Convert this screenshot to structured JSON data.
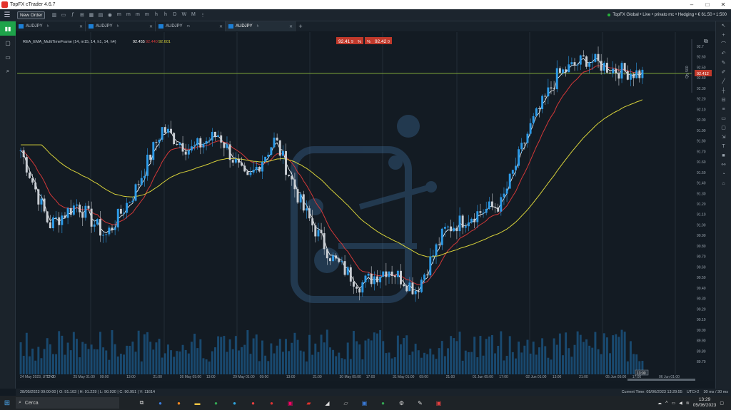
{
  "titlebar": {
    "title": "TopFX cTrader 4.6.7"
  },
  "toolbar": {
    "new_order_label": "New Order",
    "account": "TopFX Global • Live • privato mc • Hedging • € 61.50 • 1:500"
  },
  "tabs": [
    {
      "label": "AUDJPY",
      "tf": "h"
    },
    {
      "label": "AUDJPY",
      "tf": "h"
    },
    {
      "label": "AUDJPY",
      "tf": "m"
    },
    {
      "label": "AUDJPY",
      "tf": "h"
    }
  ],
  "chart": {
    "indicator_label": "REA_EMA_MultiTimeFrame (14, m15, 14, h1, 14, h4)",
    "indicator_values": [
      "92.455",
      "92.440",
      "92.601"
    ],
    "indicator_colors": [
      "#ffffff",
      "#d23838",
      "#d8d23a"
    ],
    "bid_price": "92.41",
    "bid_sup": "9",
    "ask_price": "92.42",
    "ask_sup": "0",
    "current_price_label": "92.412",
    "qty_label": "Qty 500",
    "price_labels": [
      "92.7",
      "92.60",
      "92.50",
      "92.40",
      "92.30",
      "92.20",
      "92.10",
      "92.00",
      "91.90",
      "91.80",
      "91.70",
      "91.60",
      "91.50",
      "91.40",
      "91.30",
      "91.20",
      "91.10",
      "91.00",
      "90.90",
      "90.80",
      "90.70",
      "90.60",
      "90.50",
      "90.40",
      "90.30",
      "90.20",
      "90.10",
      "90.00",
      "89.90",
      "89.80",
      "89.70"
    ],
    "time_labels": [
      "24 May 2023, UTC+2",
      "17:00",
      "25 May 01:00",
      "09:00",
      "13:00",
      "21:00",
      "26 May 05:00",
      "13:00",
      "29 May 01:00",
      "09:00",
      "13:00",
      "21:00",
      "30 May 05:00",
      "17:00",
      "31 May 01:00",
      "09:00",
      "21:00",
      "01 Jun 05:00",
      "17:00",
      "02 Jun 01:00",
      "13:00",
      "21:00",
      "05 Jun 05:00",
      "17:00",
      "06 Jun 01:00"
    ],
    "cursor_time_label": "13:00"
  },
  "chart_data": {
    "type": "candlestick",
    "symbol": "AUDJPY",
    "ylim": [
      89.7,
      92.7
    ],
    "key_closes": [
      91.7,
      91.0,
      91.2,
      90.9,
      91.3,
      91.9,
      91.7,
      91.85,
      91.4,
      91.8,
      91.15,
      90.7,
      90.45,
      90.6,
      90.4,
      90.95,
      91.1,
      91.2,
      91.9,
      92.4,
      92.55,
      92.45,
      92.41
    ],
    "series": [
      {
        "name": "EMA m15",
        "color": "#ffffff"
      },
      {
        "name": "EMA h1",
        "color": "#d23838"
      },
      {
        "name": "EMA h4",
        "color": "#d8d23a"
      }
    ]
  },
  "statusbar": {
    "ohlc": "28/05/2023 09:00:00  |  O: 91.103  |  H: 91.229  |  L: 90.930  |  C: 90.951  |  V: 11614",
    "current_time": "Current Time: 05/06/2023 13:29:55",
    "tz": "UTC+2",
    "latency": "30 ms / 30 ms"
  },
  "taskbar": {
    "search_placeholder": "Cerca",
    "time": "13:29",
    "date": "05/06/2023"
  }
}
